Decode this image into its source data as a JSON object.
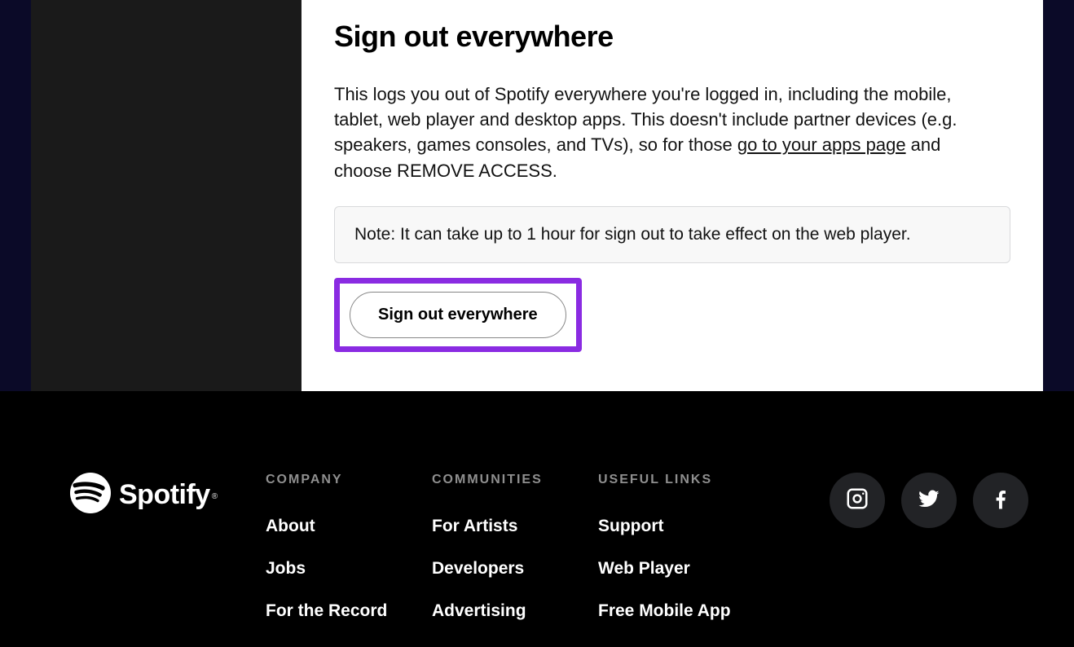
{
  "main": {
    "heading": "Sign out everywhere",
    "desc_part1": "This logs you out of Spotify everywhere you're logged in, including the mobile, tablet, web player and desktop apps. This doesn't include partner devices (e.g. speakers, games consoles, and TVs), so for those ",
    "desc_link": "go to your apps page",
    "desc_part2": " and choose REMOVE ACCESS.",
    "note": "Note: It can take up to 1 hour for sign out to take effect on the web player.",
    "button_label": "Sign out everywhere"
  },
  "footer": {
    "brand": "Spotify",
    "columns": [
      {
        "title": "COMPANY",
        "links": [
          "About",
          "Jobs",
          "For the Record"
        ]
      },
      {
        "title": "COMMUNITIES",
        "links": [
          "For Artists",
          "Developers",
          "Advertising"
        ]
      },
      {
        "title": "USEFUL LINKS",
        "links": [
          "Support",
          "Web Player",
          "Free Mobile App"
        ]
      }
    ],
    "social": [
      "instagram",
      "twitter",
      "facebook"
    ]
  },
  "colors": {
    "highlight": "#8a2be2"
  }
}
